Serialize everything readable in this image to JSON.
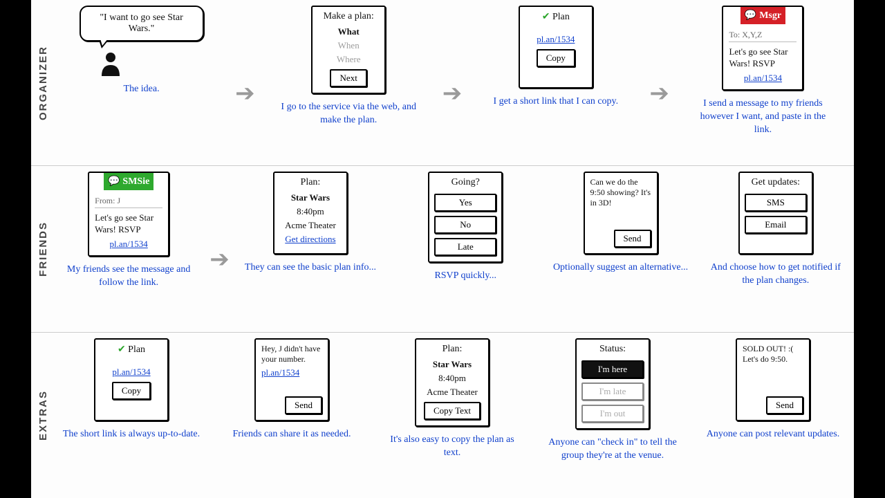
{
  "rows": {
    "organizer": "ORGANIZER",
    "friends": "FRIENDS",
    "extras": "EXTRAS"
  },
  "organizer": {
    "idea": {
      "quote": "\"I want to go see Star Wars.\"",
      "caption": "The idea."
    },
    "makePlan": {
      "title": "Make a plan:",
      "what": "What",
      "when": "When",
      "where": "Where",
      "next": "Next",
      "caption": "I go to the service via the web, and make the plan."
    },
    "shortlink": {
      "title": "Plan",
      "link": "pl.an/1534",
      "copy": "Copy",
      "caption": "I get a short link that I can copy."
    },
    "msgr": {
      "header": "Msgr",
      "to": "To: X,Y,Z",
      "body": "Let's go see Star Wars! RSVP",
      "link": "pl.an/1534",
      "caption": "I send a message to my friends however I want, and paste in the link."
    }
  },
  "friends": {
    "smsie": {
      "header": "SMSie",
      "from": "From: J",
      "body": "Let's go see Star Wars! RSVP",
      "link": "pl.an/1534",
      "caption": "My friends see the message and follow the link."
    },
    "planInfo": {
      "title": "Plan:",
      "movie": "Star Wars",
      "time": "8:40pm",
      "venue": "Acme Theater",
      "directions": "Get directions",
      "caption": "They can see the basic plan info..."
    },
    "going": {
      "title": "Going?",
      "yes": "Yes",
      "no": "No",
      "late": "Late",
      "caption": "RSVP quickly..."
    },
    "suggest": {
      "body": "Can we do the 9:50 showing? It's in 3D!",
      "send": "Send",
      "caption": "Optionally suggest an alternative..."
    },
    "updates": {
      "title": "Get updates:",
      "sms": "SMS",
      "email": "Email",
      "caption": "And choose how to get notified if the plan changes."
    }
  },
  "extras": {
    "refresh": {
      "title": "Plan",
      "link": "pl.an/1534",
      "copy": "Copy",
      "caption": "The short link is always up-to-date."
    },
    "share": {
      "body": "Hey, J didn't have your number.",
      "link": "pl.an/1534",
      "send": "Send",
      "caption": "Friends can share it as needed."
    },
    "copytext": {
      "title": "Plan:",
      "movie": "Star Wars",
      "time": "8:40pm",
      "venue": "Acme Theater",
      "btn": "Copy Text",
      "caption": "It's also easy to copy the plan as text."
    },
    "status": {
      "title": "Status:",
      "here": "I'm here",
      "late": "I'm late",
      "out": "I'm out",
      "caption": "Anyone can \"check in\" to tell the group they're at the venue."
    },
    "post": {
      "body": "SOLD OUT! :( Let's do 9:50.",
      "send": "Send",
      "caption": "Anyone can post relevant updates."
    }
  }
}
